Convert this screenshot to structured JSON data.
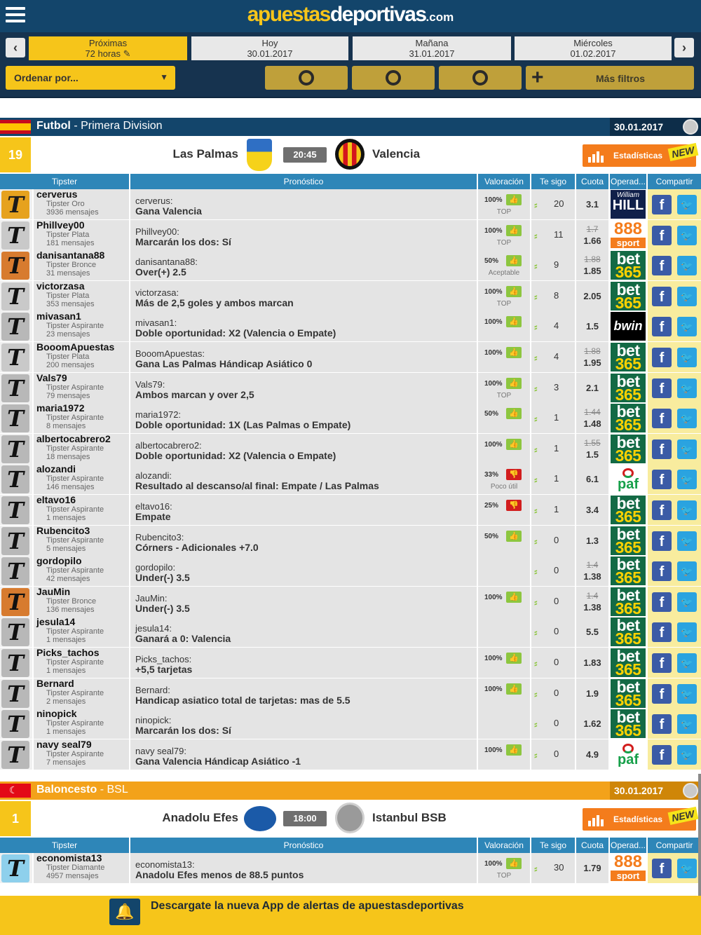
{
  "header": {
    "logo_a": "apuestas",
    "logo_d": "deportivas",
    "logo_c": ".com"
  },
  "dates": [
    {
      "top": "Próximas",
      "bottom": "72 horas ✎",
      "active": true
    },
    {
      "top": "Hoy",
      "bottom": "30.01.2017",
      "active": false
    },
    {
      "top": "Mañana",
      "bottom": "31.01.2017",
      "active": false
    },
    {
      "top": "Miércoles",
      "bottom": "01.02.2017",
      "active": false
    }
  ],
  "filters": {
    "sort_label": "Ordenar por...",
    "more_label": "Más filtros"
  },
  "columns": {
    "tipster": "Tipster",
    "pronostico": "Pronóstico",
    "valoracion": "Valoración",
    "tesigo": "Te sigo",
    "cuota": "Cuota",
    "operador": "Operad...",
    "compartir": "Compartir"
  },
  "stats_label": "Estadísticas",
  "new_badge": "NEW",
  "leagues": [
    {
      "sport": "Futbol",
      "name": " - Primera Division",
      "date": "30.01.2017",
      "color": "blue",
      "match": {
        "count": "19",
        "home": "Las Palmas",
        "time": "20:45",
        "away": "Valencia"
      },
      "rows": [
        {
          "user": "cerverus",
          "rank": "Tipster Oro",
          "msgs": "3936 mensajes",
          "av": "gold",
          "pred": "Gana Valencia",
          "pct": "100%",
          "thumb": "up",
          "vlabel": "TOP",
          "follow": "20",
          "cold": "",
          "cuota": "3.1",
          "op": "wh"
        },
        {
          "user": "Phillvey00",
          "rank": "Tipster Plata",
          "msgs": "181 mensajes",
          "av": "silver",
          "pred": "Marcarán los dos: Sí",
          "pct": "100%",
          "thumb": "up",
          "vlabel": "TOP",
          "follow": "11",
          "cold": "1.7",
          "cuota": "1.66",
          "op": "s888"
        },
        {
          "user": "danisantana88",
          "rank": "Tipster Bronce",
          "msgs": "31 mensajes",
          "av": "bronze",
          "pred": "Over(+) 2.5",
          "pct": "50%",
          "thumb": "up",
          "vlabel": "Aceptable",
          "follow": "9",
          "cold": "1.88",
          "cuota": "1.85",
          "op": "b365"
        },
        {
          "user": "victorzasa",
          "rank": "Tipster Plata",
          "msgs": "353 mensajes",
          "av": "silver",
          "pred": "Más de 2,5 goles y ambos marcan",
          "pct": "100%",
          "thumb": "up",
          "vlabel": "TOP",
          "follow": "8",
          "cold": "",
          "cuota": "2.05",
          "op": "b365"
        },
        {
          "user": "mivasan1",
          "rank": "Tipster Aspirante",
          "msgs": "23 mensajes",
          "av": "asp",
          "pred": "Doble oportunidad: X2 (Valencia o Empate)",
          "pct": "100%",
          "thumb": "up",
          "vlabel": "",
          "follow": "4",
          "cold": "",
          "cuota": "1.5",
          "op": "bwin"
        },
        {
          "user": "BooomApuestas",
          "rank": "Tipster Plata",
          "msgs": "200 mensajes",
          "av": "silver",
          "pred": "Gana Las Palmas Hándicap Asiático 0",
          "pct": "100%",
          "thumb": "up",
          "vlabel": "",
          "follow": "4",
          "cold": "1.88",
          "cuota": "1.95",
          "op": "b365"
        },
        {
          "user": "Vals79",
          "rank": "Tipster Aspirante",
          "msgs": "79 mensajes",
          "av": "asp",
          "pred": "Ambos marcan y over 2,5",
          "pct": "100%",
          "thumb": "up",
          "vlabel": "TOP",
          "follow": "3",
          "cold": "",
          "cuota": "2.1",
          "op": "b365"
        },
        {
          "user": "maria1972",
          "rank": "Tipster Aspirante",
          "msgs": "8 mensajes",
          "av": "asp",
          "pred": "Doble oportunidad: 1X (Las Palmas o Empate)",
          "pct": "50%",
          "thumb": "up",
          "vlabel": "",
          "follow": "1",
          "cold": "1.44",
          "cuota": "1.48",
          "op": "b365"
        },
        {
          "user": "albertocabrero2",
          "rank": "Tipster Aspirante",
          "msgs": "18 mensajes",
          "av": "asp",
          "pred": "Doble oportunidad: X2 (Valencia o Empate)",
          "pct": "100%",
          "thumb": "up",
          "vlabel": "",
          "follow": "1",
          "cold": "1.55",
          "cuota": "1.5",
          "op": "b365"
        },
        {
          "user": "alozandi",
          "rank": "Tipster Aspirante",
          "msgs": "146 mensajes",
          "av": "asp",
          "pred": "Resultado al descanso/al final: Empate / Las Palmas",
          "pct": "33%",
          "thumb": "down",
          "vlabel": "Poco útil",
          "follow": "1",
          "cold": "",
          "cuota": "6.1",
          "op": "paf"
        },
        {
          "user": "eltavo16",
          "rank": "Tipster Aspirante",
          "msgs": "1 mensajes",
          "av": "asp",
          "pred": "Empate",
          "pct": "25%",
          "thumb": "down",
          "vlabel": "",
          "follow": "1",
          "cold": "",
          "cuota": "3.4",
          "op": "b365"
        },
        {
          "user": "Rubencito3",
          "rank": "Tipster Aspirante",
          "msgs": "5 mensajes",
          "av": "asp",
          "pred": "Córners - Adicionales +7.0",
          "pct": "50%",
          "thumb": "up",
          "vlabel": "",
          "follow": "0",
          "cold": "",
          "cuota": "1.3",
          "op": "b365"
        },
        {
          "user": "gordopilo",
          "rank": "Tipster Aspirante",
          "msgs": "42 mensajes",
          "av": "asp",
          "pred": "Under(-) 3.5",
          "pct": "",
          "thumb": "",
          "vlabel": "",
          "follow": "0",
          "cold": "1.4",
          "cuota": "1.38",
          "op": "b365"
        },
        {
          "user": "JauMin",
          "rank": "Tipster Bronce",
          "msgs": "136 mensajes",
          "av": "bronze",
          "pred": "Under(-) 3.5",
          "pct": "100%",
          "thumb": "up",
          "vlabel": "",
          "follow": "0",
          "cold": "1.4",
          "cuota": "1.38",
          "op": "b365"
        },
        {
          "user": "jesula14",
          "rank": "Tipster Aspirante",
          "msgs": "1 mensajes",
          "av": "asp",
          "pred": "Ganará a 0: Valencia",
          "pct": "",
          "thumb": "",
          "vlabel": "",
          "follow": "0",
          "cold": "",
          "cuota": "5.5",
          "op": "b365"
        },
        {
          "user": "Picks_tachos",
          "rank": "Tipster Aspirante",
          "msgs": "1 mensajes",
          "av": "asp",
          "pred": "+5,5 tarjetas",
          "pct": "100%",
          "thumb": "up",
          "vlabel": "",
          "follow": "0",
          "cold": "",
          "cuota": "1.83",
          "op": "b365"
        },
        {
          "user": "Bernard",
          "rank": "Tipster Aspirante",
          "msgs": "2 mensajes",
          "av": "asp",
          "pred": "Handicap asiatico total de tarjetas: mas de 5.5",
          "pct": "100%",
          "thumb": "up",
          "vlabel": "",
          "follow": "0",
          "cold": "",
          "cuota": "1.9",
          "op": "b365"
        },
        {
          "user": "ninopick",
          "rank": "Tipster Aspirante",
          "msgs": "1 mensajes",
          "av": "asp",
          "pred": "Marcarán los dos: Sí",
          "pct": "",
          "thumb": "",
          "vlabel": "",
          "follow": "0",
          "cold": "",
          "cuota": "1.62",
          "op": "b365"
        },
        {
          "user": "navy seal79",
          "rank": "Tipster Aspirante",
          "msgs": "7 mensajes",
          "av": "asp",
          "pred": "Gana Valencia Hándicap Asiático -1",
          "pct": "100%",
          "thumb": "up",
          "vlabel": "",
          "follow": "0",
          "cold": "",
          "cuota": "4.9",
          "op": "paf"
        }
      ]
    },
    {
      "sport": "Baloncesto",
      "name": " - BSL",
      "date": "30.01.2017",
      "color": "orange",
      "match": {
        "count": "1",
        "home": "Anadolu Efes",
        "time": "18:00",
        "away": "Istanbul BSB"
      },
      "rows": [
        {
          "user": "economista13",
          "rank": "Tipster Diamante",
          "msgs": "4957 mensajes",
          "av": "diam",
          "pred": "Anadolu Efes menos de 88.5 puntos",
          "pct": "100%",
          "thumb": "up",
          "vlabel": "TOP",
          "follow": "30",
          "cold": "",
          "cuota": "1.79",
          "op": "s888"
        }
      ]
    }
  ],
  "banner": {
    "text": "Descargate la nueva App de alertas de apuestasdeportivas"
  },
  "operators": {
    "wh_top": "William",
    "wh_bottom": "HILL",
    "b365_top": "bet",
    "b365_bottom": "365",
    "s888_top": "888",
    "s888_bottom": "sport",
    "bwin": "bwin",
    "paf": "paf"
  },
  "colors": {
    "navy": "#13456b",
    "yellow": "#f6c51a",
    "orange": "#f3a21a",
    "column_blue": "#2e86b8"
  }
}
